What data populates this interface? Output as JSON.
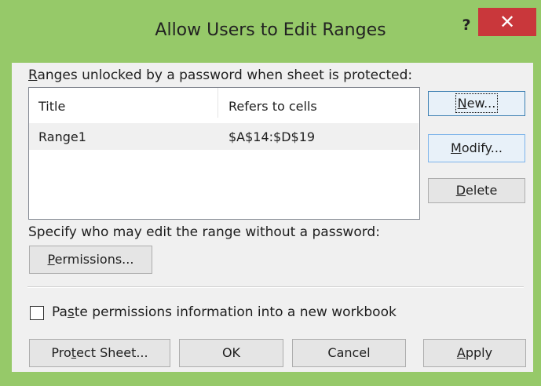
{
  "window": {
    "title": "Allow Users to Edit Ranges",
    "help_label": "?",
    "close_label": "✕",
    "frame_color": "#96c969",
    "close_color": "#c9373b"
  },
  "ranges_section": {
    "label": "Ranges unlocked by a password when sheet is protected:",
    "columns": [
      "Title",
      "Refers to cells"
    ],
    "rows": [
      {
        "title": "Range1",
        "refers_to": "$A$14:$D$19"
      }
    ]
  },
  "side_buttons": {
    "new_label": "New...",
    "modify_label": "Modify...",
    "delete_label": "Delete"
  },
  "permissions_section": {
    "label": "Specify who may edit the range without a password:",
    "button_label": "Permissions..."
  },
  "paste_checkbox": {
    "label": "Paste permissions information into a new workbook",
    "checked": false
  },
  "footer_buttons": {
    "protect_label": "Protect Sheet...",
    "ok_label": "OK",
    "cancel_label": "Cancel",
    "apply_label": "Apply"
  }
}
